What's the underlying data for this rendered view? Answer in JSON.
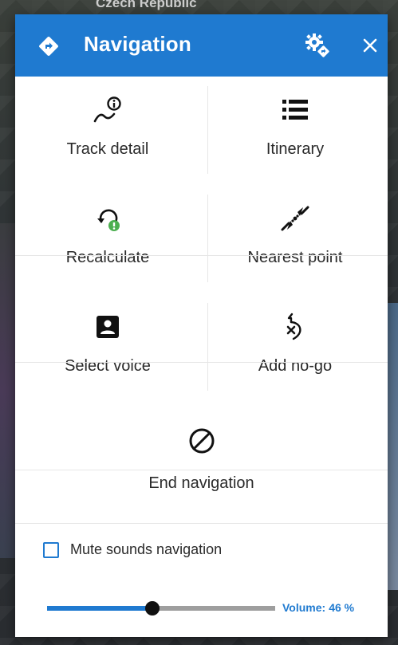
{
  "background": {
    "region_label": "Czech Republic"
  },
  "header": {
    "title": "Navigation",
    "nav_icon": "navigation-diamond-icon",
    "settings_icon": "settings-navigation-icon",
    "close_icon": "close-icon",
    "color": "#1f7ad0"
  },
  "actions": [
    {
      "label": "Track detail",
      "icon": "track-detail-icon"
    },
    {
      "label": "Itinerary",
      "icon": "list-icon"
    },
    {
      "label": "Recalculate",
      "icon": "recalculate-icon"
    },
    {
      "label": "Nearest point",
      "icon": "nearest-point-icon"
    },
    {
      "label": "Select voice",
      "icon": "voice-contact-icon"
    },
    {
      "label": "Add no-go",
      "icon": "no-go-icon"
    }
  ],
  "end_navigation": {
    "label": "End navigation",
    "icon": "block-icon"
  },
  "mute": {
    "label": "Mute sounds navigation",
    "checked": false
  },
  "volume": {
    "label": "Volume:",
    "value_text": "46 %",
    "value": 46
  }
}
